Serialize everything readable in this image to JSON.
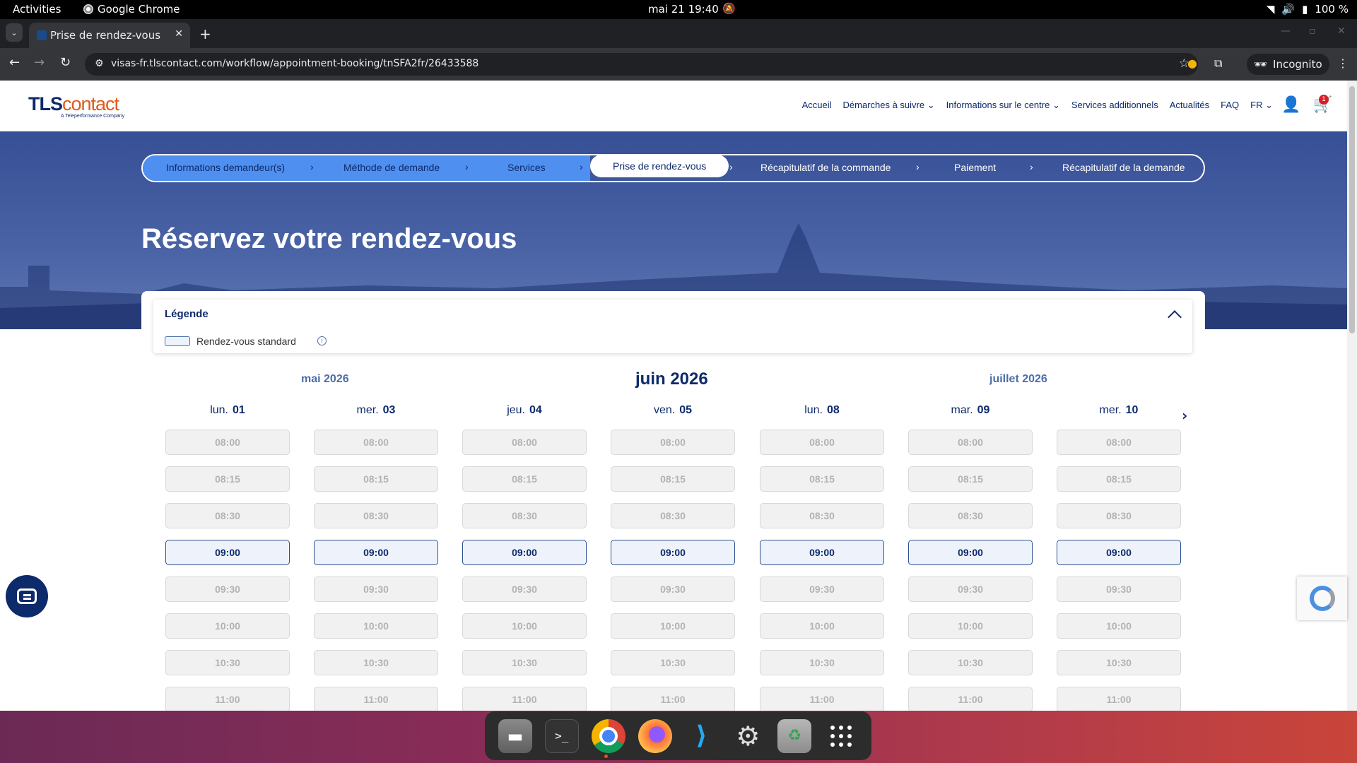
{
  "os": {
    "activities": "Activities",
    "app_name": "Google Chrome",
    "clock": "mai 21  19:40",
    "battery": "100 %"
  },
  "browser": {
    "tab_title": "Prise de rendez-vous | TLScontact",
    "url": "visas-fr.tlscontact.com/workflow/appointment-booking/tnSFA2fr/26433588",
    "incognito_label": "Incognito"
  },
  "site": {
    "logo_brand_a": "TLS",
    "logo_brand_b": "contact",
    "logo_tagline": "A Teleperformance Company",
    "nav": [
      "Accueil",
      "Démarches à suivre",
      "Informations sur le centre",
      "Services additionnels",
      "Actualités",
      "FAQ",
      "FR"
    ],
    "cart_count": "1"
  },
  "steps": [
    "Informations demandeur(s)",
    "Méthode de demande",
    "Services",
    "Prise de rendez-vous",
    "Récapitulatif de la commande",
    "Paiement",
    "Récapitulatif de la demande"
  ],
  "active_step_index": 3,
  "hero_title": "Réservez votre rendez-vous",
  "legend": {
    "title": "Légende",
    "standard_label": "Rendez-vous standard"
  },
  "months": {
    "previous": "mai 2026",
    "current": "juin 2026",
    "next": "juillet 2026"
  },
  "days": [
    {
      "weekday": "lun.",
      "num": "01"
    },
    {
      "weekday": "mer.",
      "num": "03"
    },
    {
      "weekday": "jeu.",
      "num": "04"
    },
    {
      "weekday": "ven.",
      "num": "05"
    },
    {
      "weekday": "lun.",
      "num": "08"
    },
    {
      "weekday": "mar.",
      "num": "09"
    },
    {
      "weekday": "mer.",
      "num": "10"
    }
  ],
  "slots": [
    "08:00",
    "08:15",
    "08:30",
    "09:00",
    "09:30",
    "10:00",
    "10:30",
    "11:00"
  ],
  "available_slot": "09:00",
  "colors": {
    "brand_navy": "#0d2a6b",
    "brand_orange": "#e05a1a",
    "stepper_done": "#4f8fef",
    "hero_blue": "#2a4896"
  }
}
